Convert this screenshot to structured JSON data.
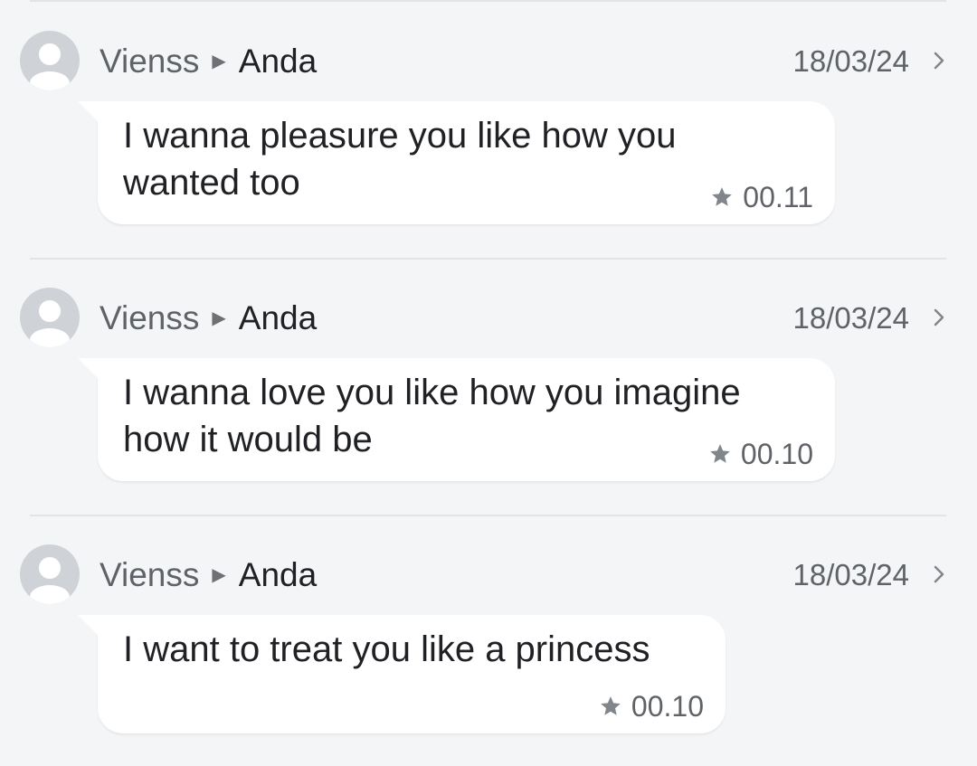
{
  "messages": [
    {
      "sender": "Vienss",
      "recipient": "Anda",
      "date": "18/03/24",
      "text_line1": "I wanna pleasure you like how you",
      "text_line2": "wanted too",
      "time": "00.11",
      "icons": {
        "avatar": "avatar-placeholder-icon",
        "arrow": "arrow-right-icon",
        "chevron": "chevron-right-icon",
        "star": "star-icon"
      }
    },
    {
      "sender": "Vienss",
      "recipient": "Anda",
      "date": "18/03/24",
      "text_line1": "I wanna love you like how you imagine",
      "text_line2": "how it would be",
      "time": "00.10",
      "icons": {
        "avatar": "avatar-placeholder-icon",
        "arrow": "arrow-right-icon",
        "chevron": "chevron-right-icon",
        "star": "star-icon"
      }
    },
    {
      "sender": "Vienss",
      "recipient": "Anda",
      "date": "18/03/24",
      "text_line1": "I want to treat you like a princess",
      "text_line2": "",
      "time": "00.10",
      "icons": {
        "avatar": "avatar-placeholder-icon",
        "arrow": "arrow-right-icon",
        "chevron": "chevron-right-icon",
        "star": "star-icon"
      }
    }
  ],
  "colors": {
    "background": "#f4f5f7",
    "bubble": "#ffffff",
    "text": "#202124",
    "secondary_text": "#5f6368",
    "avatar": "#cfd3d8",
    "divider": "#e2e4e7"
  }
}
